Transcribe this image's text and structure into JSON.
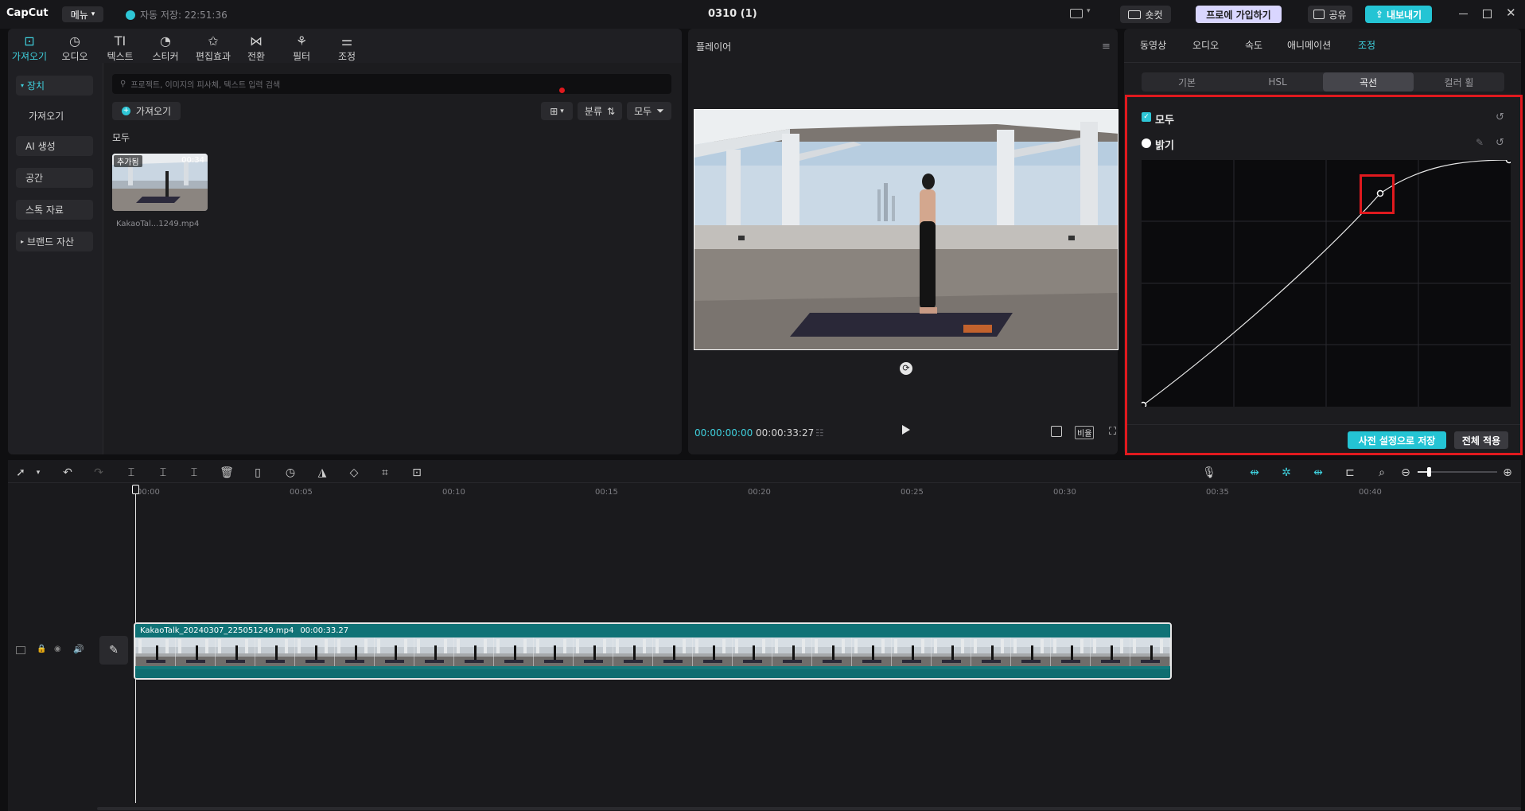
{
  "topbar": {
    "logo": "CapCut",
    "menu_label": "메뉴",
    "autosave": "자동 저장: 22:51:36",
    "project_title": "0310 (1)",
    "shortcut_label": "숏컷",
    "pro_label": "프로에 가입하기",
    "share_label": "공유",
    "export_label": "내보내기"
  },
  "media_tabs": [
    {
      "label": "가져오기",
      "icon": "import-icon"
    },
    {
      "label": "오디오",
      "icon": "audio-icon"
    },
    {
      "label": "텍스트",
      "icon": "text-icon"
    },
    {
      "label": "스티커",
      "icon": "sticker-icon"
    },
    {
      "label": "편집효과",
      "icon": "effects-icon"
    },
    {
      "label": "전환",
      "icon": "transition-icon"
    },
    {
      "label": "필터",
      "icon": "filter-icon"
    },
    {
      "label": "조정",
      "icon": "adjust-icon"
    }
  ],
  "sidebar": {
    "items": [
      {
        "label": "장치"
      },
      {
        "label": "가져오기"
      },
      {
        "label": "AI 생성"
      },
      {
        "label": "공간"
      },
      {
        "label": "스톡 자료"
      },
      {
        "label": "브랜드 자산"
      }
    ]
  },
  "media": {
    "search_placeholder": "프로젝트, 이미지의 피사체, 텍스트 입력 검색",
    "import_button": "가져오기",
    "sort_label": "분류",
    "filter_label": "모두",
    "section_label": "모두",
    "thumb_badge": "추가됨",
    "thumb_duration": "00:34",
    "thumb_filename": "KakaoTal...1249.mp4"
  },
  "player": {
    "title": "플레이어",
    "current_time": "00:00:00:00",
    "total_time": "00:00:33:27",
    "ratio_label": "비율"
  },
  "props": {
    "tabs": [
      "동영상",
      "오디오",
      "속도",
      "애니메이션",
      "조정"
    ],
    "subtabs": [
      "기본",
      "HSL",
      "곡선",
      "컬러 휠"
    ],
    "all_label": "모두",
    "brightness_label": "밝기",
    "save_preset": "사전 설정으로 저장",
    "apply_all": "전체 적용"
  },
  "timeline": {
    "ruler": [
      "00:00",
      "00:05",
      "00:10",
      "00:15",
      "00:20",
      "00:25",
      "00:30",
      "00:35",
      "00:40"
    ],
    "clip_label": "KakaoTalk_20240307_225051249.mp4",
    "clip_duration": "00:00:33.27"
  },
  "colors": {
    "accent": "#3fd0dd",
    "highlight_red": "#e0191e",
    "clip_teal": "#137a7d"
  }
}
